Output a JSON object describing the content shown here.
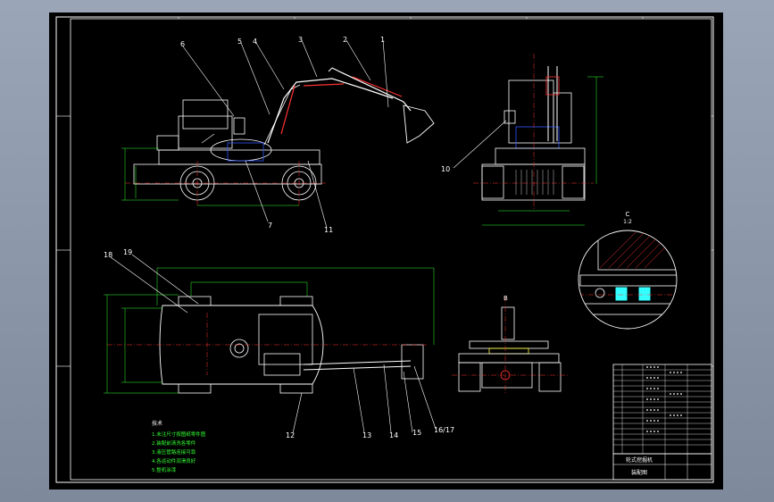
{
  "drawing": {
    "colors": {
      "background": "#000000",
      "frame": "#ffffff",
      "outline": "#ffffff",
      "dimension": "#33ff33",
      "center_line": "#ff3333",
      "hidden": "#3355ff",
      "section": "#ff3333",
      "highlight": "#33ffff",
      "gasket": "#ffff33",
      "hatch": "#ff3333",
      "app_bg": "#8a96a8"
    },
    "balloons": [
      "1",
      "2",
      "3",
      "4",
      "5",
      "6",
      "7",
      "10",
      "11",
      "12",
      "13",
      "14",
      "15",
      "16/17",
      "18",
      "19",
      "B"
    ],
    "notes": {
      "heading": "技术",
      "lines": [
        "1.未注尺寸按图纸零件图",
        "2.装配前清洗各零件",
        "3.液压管路连接可靠",
        "4.各运动件润滑良好",
        "5.整机涂漆"
      ]
    },
    "detail_label": "C",
    "detail_scale": "1:2",
    "title_block": {
      "name": "轮式挖掘机",
      "sheet": "装配图"
    }
  }
}
